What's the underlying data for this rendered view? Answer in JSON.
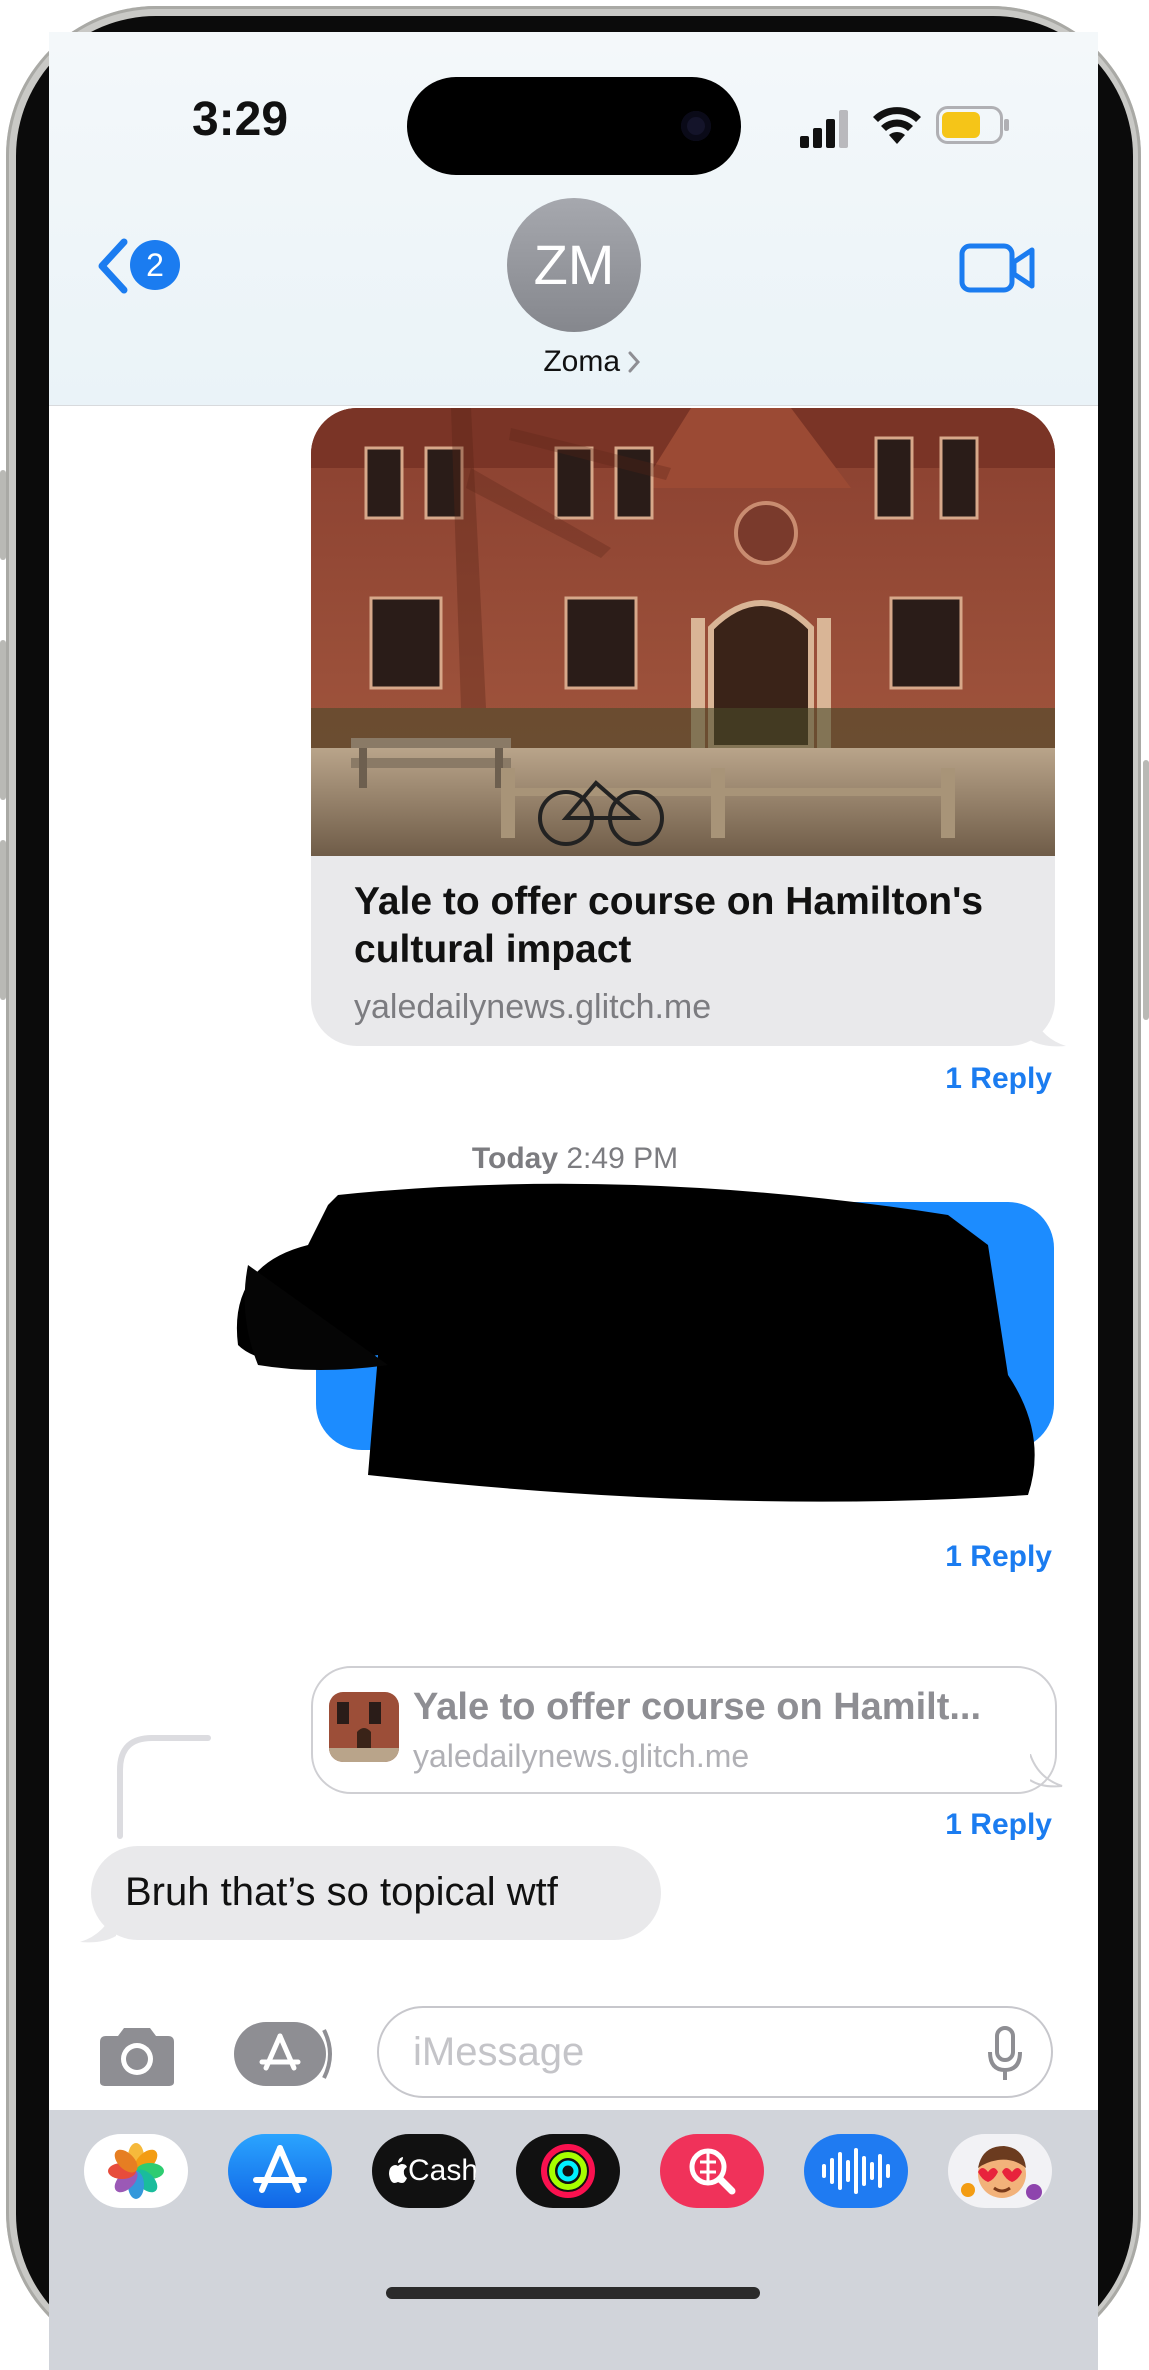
{
  "status_bar": {
    "time": "3:29"
  },
  "header": {
    "back_badge": "2",
    "avatar_initials": "ZM",
    "contact_name": "Zoma"
  },
  "messages": {
    "link_card": {
      "title": "Yale to offer course on Hamilton's cultural impact",
      "domain": "yaledailynews.glitch.me",
      "reply_label": "1 Reply"
    },
    "timestamp": {
      "day": "Today",
      "time": "2:49 PM"
    },
    "redacted_message": {
      "reply_label": "1 Reply"
    },
    "quoted_reply": {
      "title": "Yale to offer course on Hamilt...",
      "domain": "yaledailynews.glitch.me",
      "reply_label": "1 Reply"
    },
    "incoming": {
      "text": "Bruh that’s so topical wtf"
    }
  },
  "composer": {
    "placeholder": "iMessage"
  },
  "app_drawer": {
    "apps": [
      "photos-icon",
      "app-store-icon",
      "apple-cash-icon",
      "fitness-icon",
      "search-images-icon",
      "audio-message-icon",
      "memoji-icon"
    ],
    "cash_label": "Cash"
  },
  "colors": {
    "accent": "#1b7cf0",
    "bubble_sent": "#1c8cff",
    "bubble_received": "#e9e9eb"
  }
}
